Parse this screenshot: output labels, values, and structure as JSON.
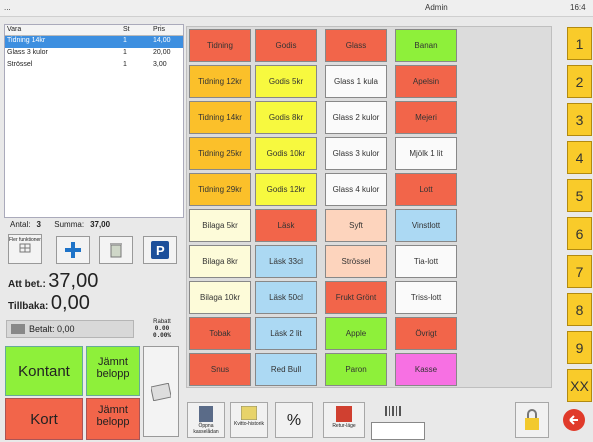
{
  "topbar": {
    "left": "...",
    "user": "Admin",
    "time": "16:4"
  },
  "receipt": {
    "headers": {
      "item": "Vara",
      "qty": "St",
      "price": "Pris"
    },
    "rows": [
      {
        "item": "Tidning 14kr",
        "qty": "1",
        "price": "14,00"
      },
      {
        "item": "Glass 3 kulor",
        "qty": "1",
        "price": "20,00"
      },
      {
        "item": "Strössel",
        "qty": "1",
        "price": "3,00"
      }
    ]
  },
  "summary": {
    "count_label": "Antal:",
    "count": "3",
    "sum_label": "Summa:",
    "sum": "37,00"
  },
  "more_functions": "Fler funktioner",
  "payment": {
    "to_pay_label": "Att bet.:",
    "to_pay": "37,00",
    "change_label": "Tillbaka:",
    "change": "0,00",
    "paid_label": "Betalt: 0,00",
    "discount_label": "Rabatt",
    "discount_amount": "0.00",
    "discount_pct": "0.00%"
  },
  "pay_buttons": {
    "cash": "Kontant",
    "even": "Jämnt",
    "even2": "belopp",
    "card": "Kort",
    "even3": "Jämnt",
    "even4": "belopp"
  },
  "products": [
    [
      "Tidning",
      "Godis",
      "Glass",
      "Banan"
    ],
    [
      "Tidning 12kr",
      "Godis 5kr",
      "Glass 1 kula",
      "Apelsin"
    ],
    [
      "Tidning 14kr",
      "Godis 8kr",
      "Glass 2 kulor",
      "Mejeri"
    ],
    [
      "Tidning 25kr",
      "Godis 10kr",
      "Glass 3 kulor",
      "Mjölk 1 lit"
    ],
    [
      "Tidning 29kr",
      "Godis 12kr",
      "Glass 4 kulor",
      "Lott"
    ],
    [
      "Bilaga 5kr",
      "Läsk",
      "Syft",
      "Vinstlott"
    ],
    [
      "Bilaga 8kr",
      "Läsk 33cl",
      "Strössel",
      "Tia-lott"
    ],
    [
      "Bilaga 10kr",
      "Läsk 50cl",
      "Frukt Grönt",
      "Triss-lott"
    ],
    [
      "Tobak",
      "Läsk 2 lit",
      "Apple",
      "Övrigt"
    ],
    [
      "Snus",
      "Red Bull",
      "Paron",
      "Kasse"
    ]
  ],
  "numbers": [
    "1",
    "2",
    "3",
    "4",
    "5",
    "6",
    "7",
    "8",
    "9",
    "XX"
  ],
  "bottom": {
    "drawer": "Öppna kasselådan",
    "receipt": "Kvitto-historik",
    "return": "Retur-läge"
  },
  "colors": {
    "selection": "#3d8fe0",
    "numpad": "#f9cb2a",
    "cash": "#8ef03a",
    "card": "#f2654a"
  }
}
